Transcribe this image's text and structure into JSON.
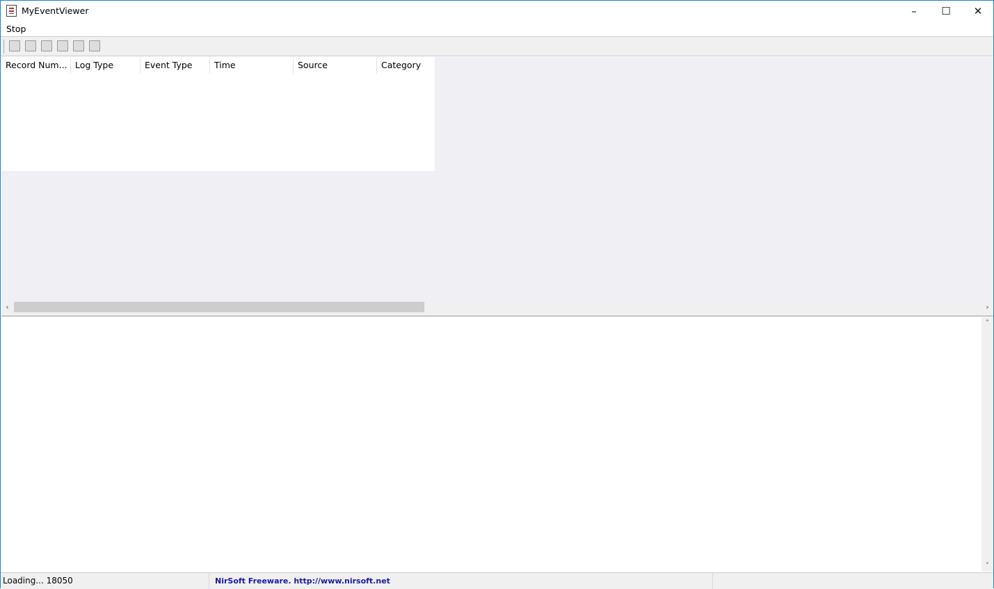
{
  "window": {
    "title": "MyEventViewer",
    "minimize": "–",
    "maximize": "☐",
    "close": "✕"
  },
  "menu": {
    "items": [
      {
        "label": "Stop"
      }
    ]
  },
  "toolbar": {
    "buttons": [
      {
        "icon": "save-icon"
      },
      {
        "icon": "refresh-icon"
      },
      {
        "icon": "copy-icon"
      },
      {
        "icon": "properties-icon"
      },
      {
        "icon": "find-icon"
      },
      {
        "icon": "exit-icon"
      }
    ]
  },
  "list": {
    "columns": [
      "Record Num...",
      "Log Type",
      "Event Type",
      "Time",
      "Source",
      "Category"
    ],
    "rows": []
  },
  "scroll": {
    "left": "‹",
    "right": "›",
    "up": "˄",
    "down": "˅"
  },
  "status": {
    "loading": "Loading... 18050",
    "credit": "NirSoft Freeware.  http://www.nirsoft.net"
  }
}
